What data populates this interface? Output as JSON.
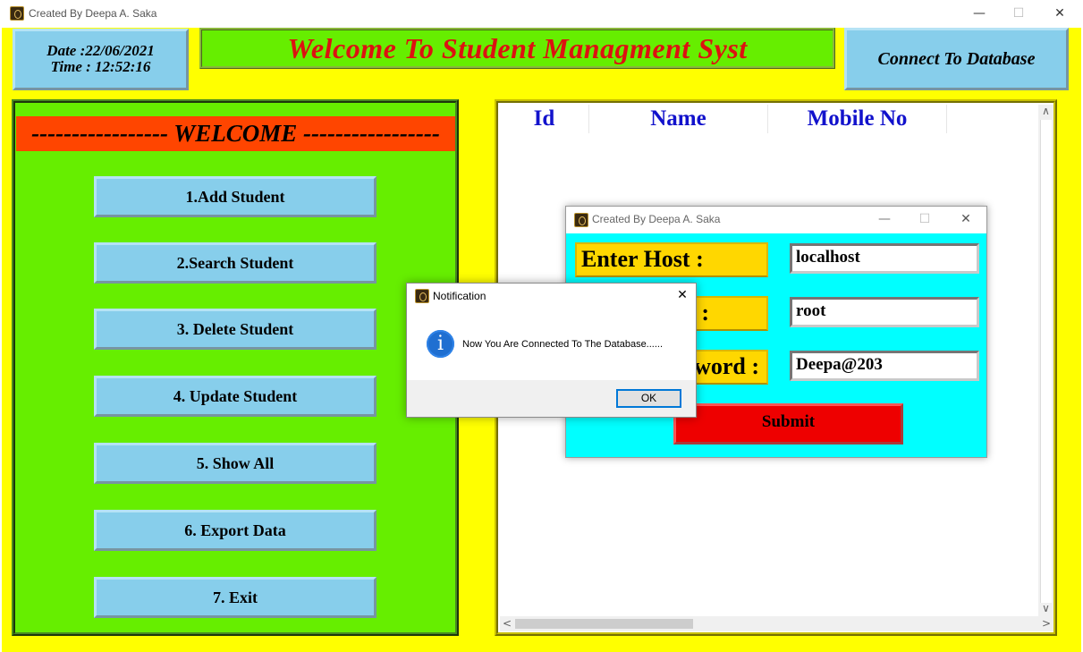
{
  "window": {
    "title": "Created By Deepa A. Saka",
    "minimize": "—",
    "maximize": "☐",
    "close": "✕"
  },
  "header": {
    "date_label": "Date :22/06/2021",
    "time_label": "Time : 12:52:16",
    "banner_title": "Welcome To Student Managment Syst",
    "connect_button": "Connect To Database"
  },
  "menu": {
    "heading": "----------------- WELCOME -----------------",
    "items": [
      {
        "label": "1.Add Student"
      },
      {
        "label": "2.Search Student"
      },
      {
        "label": "3. Delete Student"
      },
      {
        "label": "4. Update Student"
      },
      {
        "label": "5. Show All"
      },
      {
        "label": "6. Export Data"
      },
      {
        "label": "7. Exit"
      }
    ]
  },
  "table": {
    "columns": [
      "Id",
      "Name",
      "Mobile No"
    ],
    "rows": [],
    "scroll_left": "<",
    "scroll_right": ">",
    "scroll_down": "∨",
    "scroll_up": "∧"
  },
  "db_dialog": {
    "title": "Created By Deepa A. Saka",
    "minimize": "—",
    "maximize": "☐",
    "close": "✕",
    "host_label": "Enter Host :",
    "user_label": ":",
    "password_label": "word :",
    "host_value": "localhost",
    "user_value": "root",
    "password_value": "Deepa@203",
    "submit_label": "Submit"
  },
  "notification": {
    "title": "Notification",
    "close": "✕",
    "message": "Now You Are Connected To The Database......",
    "ok_label": "OK",
    "icon": "i"
  },
  "colors": {
    "background": "#ffff00",
    "menu_panel": "#66ee00",
    "banner_text": "#dd1111",
    "buttons": "#87ceeb",
    "header_strip": "#ff4500",
    "column_headers": "#1212cc",
    "dialog_bg": "#00ffff",
    "labels": "#ffd700",
    "submit": "#ee0000"
  }
}
